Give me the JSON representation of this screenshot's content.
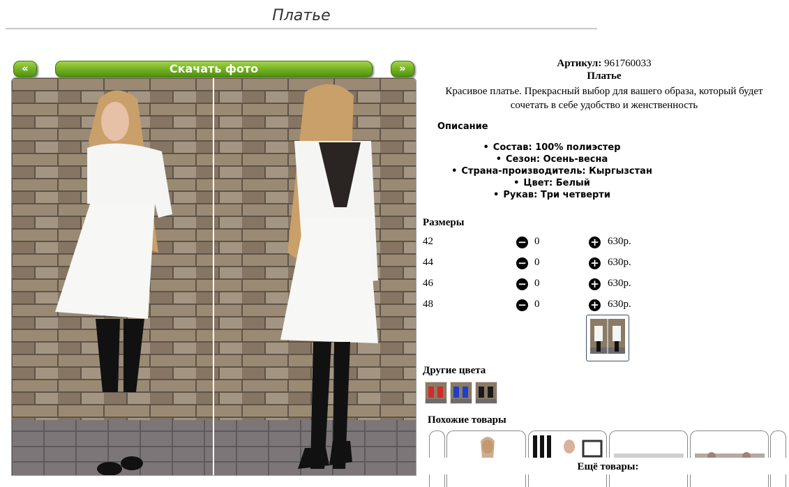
{
  "page": {
    "title": "Платье"
  },
  "gallery": {
    "prev_label": "«",
    "download_label": "Скачать фото",
    "next_label": "»"
  },
  "product": {
    "article_label": "Артикул:",
    "article_value": "961760033",
    "name": "Платье",
    "description": "Красивое платье. Прекрасный выбор для вашего образа, который будет сочетать в себе удобство и женственность",
    "section_title": "Описание",
    "properties": [
      "Состав: 100% полиэстер",
      "Сезон: Осень-весна",
      "Страна-производитель: Кыргызстан",
      "Цвет: Белый",
      "Рукав: Три четверти"
    ]
  },
  "sizes": {
    "title": "Размеры",
    "rows": [
      {
        "size": "42",
        "qty": "0",
        "price": "630р."
      },
      {
        "size": "44",
        "qty": "0",
        "price": "630р."
      },
      {
        "size": "46",
        "qty": "0",
        "price": "630р."
      },
      {
        "size": "48",
        "qty": "0",
        "price": "630р."
      }
    ],
    "minus_symbol": "−",
    "plus_symbol": "+"
  },
  "other_colors": {
    "title": "Другие цвета",
    "swatches": [
      "red",
      "blue",
      "black"
    ]
  },
  "similar": {
    "title": "Похожие товары",
    "more_label": "Ещё товары:"
  },
  "colors": {
    "button_green": "#78b626",
    "dress": "#f4f4f2",
    "brick": "#8a7a66"
  }
}
